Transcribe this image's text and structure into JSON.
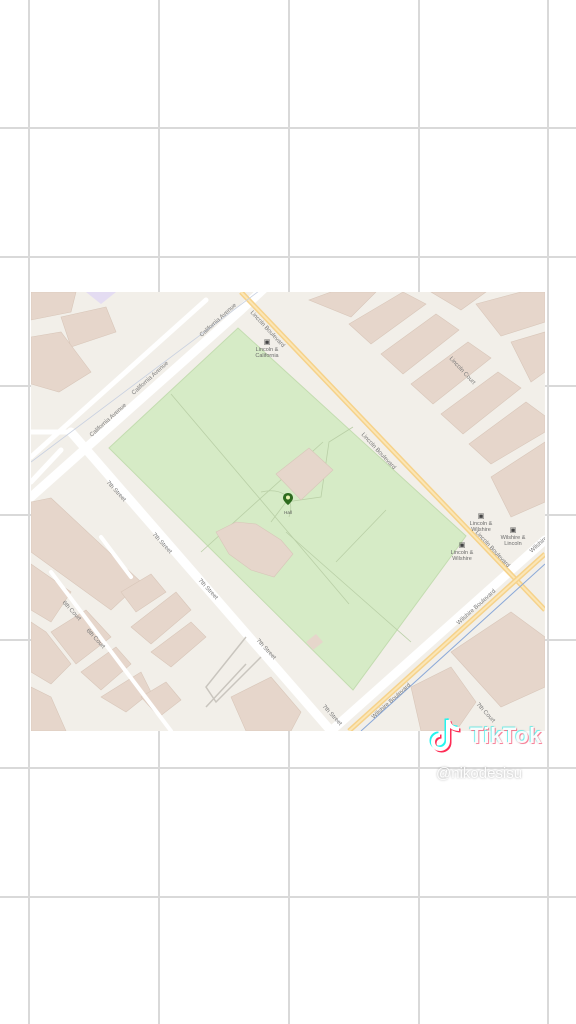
{
  "map": {
    "streets": {
      "california_ave_1": "California Avenue",
      "california_ave_2": "California Avenue",
      "california_ave_3": "California Avenue",
      "lincoln_blvd_1": "Lincoln Boulevard",
      "lincoln_blvd_2": "Lincoln Boulevard",
      "lincoln_blvd_3": "Lincoln Boulevard",
      "lincoln_court": "Lincoln Court",
      "seventh_street_1": "7th Street",
      "seventh_street_2": "7th Street",
      "seventh_street_3": "7th Street",
      "seventh_street_4": "7th Street",
      "seventh_street_5": "7th Street",
      "sixth_court_1": "6th Court",
      "sixth_court_2": "6th Court",
      "wilshire_blvd_1": "Wilshire Boulevard",
      "wilshire_blvd_2": "Wilshire Boulevard",
      "wilshire_blvd_3": "Wilshire",
      "seventh_court": "7th Court"
    },
    "stations": {
      "lincoln_california": "Lincoln & California",
      "lincoln_wilshire": "Lincoln & Wilshire",
      "wilshire_lincoln": "Wilshire & Lincoln",
      "lincoln_wilshire_2": "Lincoln & Wilshire"
    },
    "poi": {
      "park_marker": "Hall"
    },
    "colors": {
      "land": "#f2efe9",
      "park": "#d6ebc6",
      "building": "#e4d4c8",
      "road": "#ffffff",
      "major_road": "#f6d28a",
      "rail": "#8aa8d8"
    }
  },
  "watermark": {
    "brand": "TikTok",
    "handle": "@nikodesisu"
  }
}
